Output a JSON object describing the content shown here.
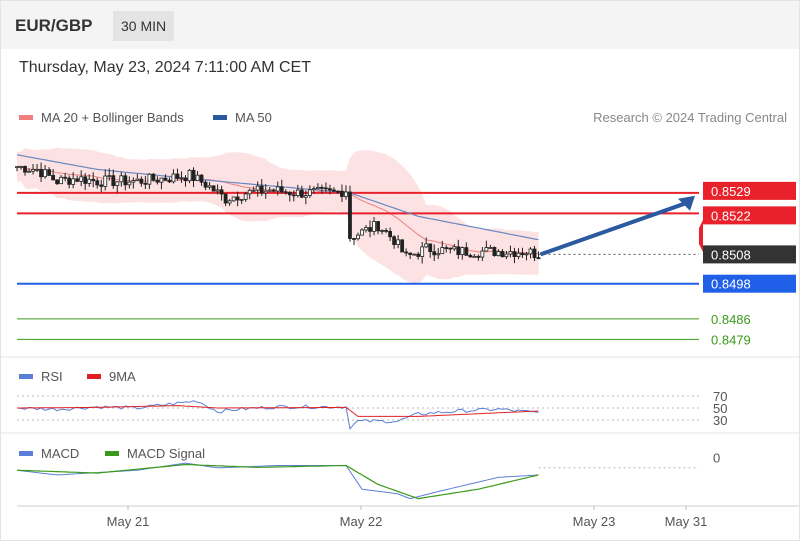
{
  "header": {
    "symbol": "EUR/GBP",
    "timeframe": "30 MIN"
  },
  "datetime": "Thursday, May 23, 2024 7:11:00 AM CET",
  "legend_main": [
    {
      "label": "MA 20 + Bollinger Bands",
      "color": "#f08080"
    },
    {
      "label": "MA 50",
      "color": "#2c5aa0"
    }
  ],
  "credit": "Research © 2024 Trading Central",
  "legend_rsi": [
    {
      "label": "RSI",
      "color": "#5b7fd6"
    },
    {
      "label": "9MA",
      "color": "#e02020"
    }
  ],
  "legend_macd": [
    {
      "label": "MACD",
      "color": "#5b7fd6"
    },
    {
      "label": "MACD Signal",
      "color": "#3a9a1a"
    }
  ],
  "colors": {
    "resistance": "#e8212b",
    "current": "#333333",
    "support": "#2060e8",
    "target": "#3a9a1a",
    "arrow": "#2c5aa0"
  },
  "chart_data": {
    "type": "candlestick",
    "ylim": [
      0.8474,
      0.8545
    ],
    "x_ticks": [
      "May 21",
      "May 22",
      "May 23",
      "May 31"
    ],
    "levels": [
      {
        "price": 0.8529,
        "label": "0.8529",
        "kind": "resistance"
      },
      {
        "price": 0.8522,
        "label": "0.8522",
        "kind": "resistance"
      },
      {
        "price": 0.8508,
        "label": "0.8508",
        "kind": "current"
      },
      {
        "price": 0.8498,
        "label": "0.8498",
        "kind": "support"
      },
      {
        "price": 0.8486,
        "label": "0.8486",
        "kind": "target"
      },
      {
        "price": 0.8479,
        "label": "0.8479",
        "kind": "target"
      }
    ],
    "close_keypoints": [
      [
        0,
        0.8538
      ],
      [
        5,
        0.8537
      ],
      [
        10,
        0.8533
      ],
      [
        15,
        0.8534
      ],
      [
        20,
        0.8533
      ],
      [
        25,
        0.8533
      ],
      [
        30,
        0.8533
      ],
      [
        37,
        0.8534
      ],
      [
        43,
        0.8535
      ],
      [
        47,
        0.8532
      ],
      [
        52,
        0.8527
      ],
      [
        57,
        0.8529
      ],
      [
        63,
        0.853
      ],
      [
        70,
        0.8529
      ],
      [
        79,
        0.8529
      ],
      [
        82,
        0.853
      ],
      [
        83,
        0.8514
      ],
      [
        85,
        0.8515
      ],
      [
        90,
        0.8518
      ],
      [
        94,
        0.8513
      ],
      [
        97,
        0.8507
      ],
      [
        102,
        0.851
      ],
      [
        110,
        0.8509
      ],
      [
        120,
        0.8509
      ],
      [
        127,
        0.8509
      ],
      [
        130,
        0.8508
      ]
    ],
    "ma50_keypoints": [
      [
        0,
        0.8542
      ],
      [
        20,
        0.8537
      ],
      [
        50,
        0.8533
      ],
      [
        83,
        0.8529
      ],
      [
        100,
        0.8521
      ],
      [
        130,
        0.8513
      ]
    ],
    "rsi": {
      "levels": [
        70,
        50,
        30
      ],
      "rsi_keypoints": [
        [
          0,
          50
        ],
        [
          10,
          48
        ],
        [
          20,
          52
        ],
        [
          30,
          50
        ],
        [
          40,
          58
        ],
        [
          45,
          62
        ],
        [
          50,
          44
        ],
        [
          55,
          48
        ],
        [
          65,
          52
        ],
        [
          82,
          52
        ],
        [
          83,
          18
        ],
        [
          85,
          28
        ],
        [
          95,
          28
        ],
        [
          100,
          40
        ],
        [
          110,
          45
        ],
        [
          120,
          48
        ],
        [
          130,
          42
        ]
      ],
      "ma_keypoints": [
        [
          0,
          50
        ],
        [
          20,
          51
        ],
        [
          40,
          54
        ],
        [
          50,
          50
        ],
        [
          82,
          51
        ],
        [
          85,
          36
        ],
        [
          100,
          36
        ],
        [
          130,
          45
        ]
      ]
    },
    "macd": {
      "levels": [
        0
      ],
      "macd_keypoints": [
        [
          0,
          -0.0002
        ],
        [
          10,
          -0.0003
        ],
        [
          20,
          -0.00025
        ],
        [
          30,
          -0.0002
        ],
        [
          42,
          -5e-05
        ],
        [
          50,
          -0.00015
        ],
        [
          65,
          -0.0001
        ],
        [
          82,
          -0.0001
        ],
        [
          86,
          -0.0006
        ],
        [
          95,
          -0.0007
        ],
        [
          98,
          -0.0008
        ],
        [
          105,
          -0.00065
        ],
        [
          120,
          -0.00035
        ],
        [
          130,
          -0.0003
        ]
      ],
      "signal_keypoints": [
        [
          0,
          -0.0002
        ],
        [
          20,
          -0.00026
        ],
        [
          42,
          -8e-05
        ],
        [
          60,
          -0.00014
        ],
        [
          82,
          -0.0001
        ],
        [
          90,
          -0.0005
        ],
        [
          100,
          -0.0008
        ],
        [
          115,
          -0.0006
        ],
        [
          130,
          -0.0003
        ]
      ]
    }
  }
}
